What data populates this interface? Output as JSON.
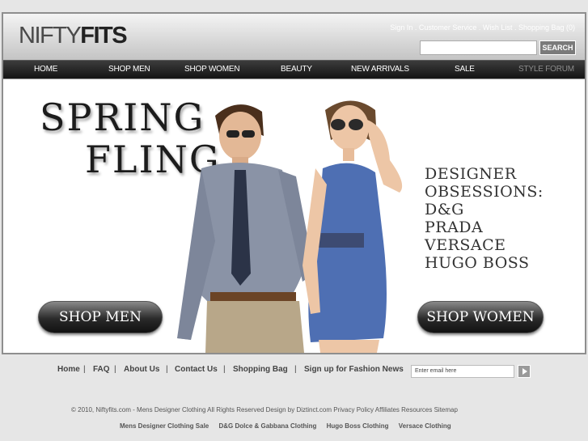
{
  "brand": {
    "logo_part1": "NIFTY",
    "logo_part2": "FITS"
  },
  "header": {
    "utility_links": "Sign In . Customer Service . Wish List . Shopping Bag (0)",
    "search_value": "",
    "search_button": "SEARCH"
  },
  "nav": {
    "items": [
      "HOME",
      "SHOP MEN",
      "SHOP WOMEN",
      "BEAUTY",
      "NEW ARRIVALS",
      "SALE",
      "STYLE FORUM"
    ]
  },
  "hero": {
    "title_line1": "SPRING",
    "title_line2": "FLING",
    "brands": [
      "DESIGNER",
      "OBSESSIONS:",
      "D&G",
      "PRADA",
      "VERSACE",
      "HUGO BOSS"
    ],
    "shop_men": "SHOP MEN",
    "shop_women": "SHOP WOMEN"
  },
  "footer": {
    "links": [
      "Home",
      "FAQ",
      "About Us",
      "Contact Us",
      "Shopping Bag",
      "Sign up for Fashion News"
    ],
    "email_placeholder": "Enter email here",
    "copyright": "© 2010, Niftyfits.com - Mens Designer Clothing  All Rights Reserved    Design by Diztinct.com    Privacy Policy    Affiliates    Resources    Sitemap",
    "seo_links": [
      "Mens Designer Clothing Sale",
      "D&G Dolce & Gabbana Clothing",
      "Hugo Boss Clothing",
      "Versace Clothing"
    ]
  }
}
